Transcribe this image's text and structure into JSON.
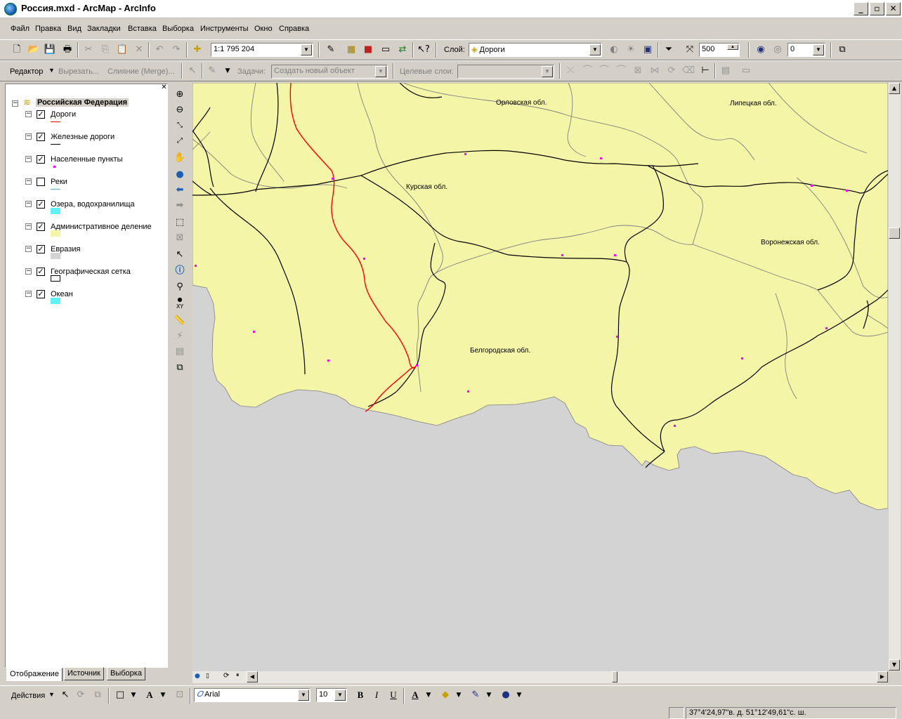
{
  "window": {
    "title": "Россия.mxd - ArcMap - ArcInfo"
  },
  "menu": [
    "Файл",
    "Правка",
    "Вид",
    "Закладки",
    "Вставка",
    "Выборка",
    "Инструменты",
    "Окно",
    "Справка"
  ],
  "standard_toolbar": {
    "scale": "1:1 795 204",
    "layer_label": "Слой:",
    "layer_value": "Дороги",
    "zoom_value": "500",
    "index_value": "0"
  },
  "editor_toolbar": {
    "editor_label": "Редактор",
    "cut_label": "Вырезать...",
    "merge_label": "Слияние (Merge)...",
    "task_label": "Задачи:",
    "task_value": "Создать новый объект",
    "target_label": "Целевые слои:",
    "target_value": ""
  },
  "toc": {
    "root": "Российская Федерация",
    "layers": [
      {
        "name": "Дороги",
        "checked": true,
        "legend": "line",
        "color": "#ff0000"
      },
      {
        "name": "Железные дороги",
        "checked": true,
        "legend": "line",
        "color": "#000000"
      },
      {
        "name": "Населенные пункты",
        "checked": true,
        "legend": "point",
        "color": "#ff00ff"
      },
      {
        "name": "Реки",
        "checked": false,
        "legend": "line",
        "color": "#5fa8d8"
      },
      {
        "name": "Озера, водохранилища",
        "checked": true,
        "legend": "fill",
        "color": "#5ff0f8"
      },
      {
        "name": "Административное деление",
        "checked": true,
        "legend": "fill",
        "color": "#f5f5a8"
      },
      {
        "name": "Евразия",
        "checked": true,
        "legend": "fill",
        "color": "#d3d3d3"
      },
      {
        "name": "Географическая сетка",
        "checked": true,
        "legend": "fill",
        "color": "#ffffff"
      },
      {
        "name": "Океан",
        "checked": true,
        "legend": "fill",
        "color": "#5ff0f8"
      }
    ],
    "tabs": [
      "Отображение",
      "Источник",
      "Выборка"
    ]
  },
  "map": {
    "labels": [
      "Орловская обл.",
      "Липецкая обл.",
      "Курская обл.",
      "Воронежская обл.",
      "Белгородская обл."
    ]
  },
  "draw_toolbar": {
    "actions_label": "Действия",
    "font": "Arial",
    "font_size": "10",
    "bold": "B",
    "italic": "I",
    "underline": "U",
    "font_color": "A"
  },
  "status": {
    "coordinates": "37°4'24,97\"в. д.  51°12'49,61\"с. ш."
  },
  "colors": {
    "land": "#f5f5a8",
    "background": "#d3d3d3",
    "road": "#ff0000",
    "railway": "#000000",
    "boundary": "#808080",
    "settlement": "#ff00ff"
  }
}
